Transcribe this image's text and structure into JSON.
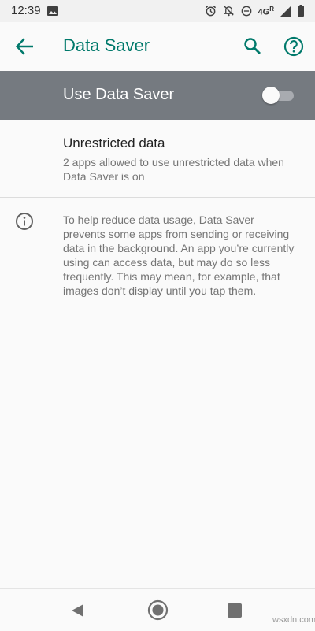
{
  "status_bar": {
    "time": "12:39",
    "network_type": "4G",
    "network_sup": "R",
    "icons": [
      "image-icon",
      "alarm-icon",
      "notifications-off-icon",
      "do-not-disturb-icon",
      "signal-icon",
      "battery-icon"
    ]
  },
  "app_bar": {
    "title": "Data Saver",
    "back_icon": "arrow-back-icon",
    "search_icon": "search-icon",
    "help_icon": "help-icon"
  },
  "master_switch": {
    "label": "Use Data Saver",
    "checked": false
  },
  "unrestricted_data": {
    "title": "Unrestricted data",
    "summary": "2 apps allowed to use unrestricted data when Data Saver is on"
  },
  "footer": {
    "info_icon": "info-icon",
    "text": "To help reduce data usage, Data Saver prevents some apps from sending or receiving data in the background. An app you’re currently using can access data, but may do so less frequently. This may mean, for example, that images don’t display until you tap them."
  },
  "nav_bar": {
    "icons": [
      "nav-back-icon",
      "nav-home-icon",
      "nav-recents-icon"
    ]
  },
  "watermark": "wsxdn.com",
  "colors": {
    "accent": "#00796b",
    "switch_bar": "#757a80",
    "background": "#fafafa",
    "primary_text": "#212121",
    "secondary_text": "#757575"
  }
}
